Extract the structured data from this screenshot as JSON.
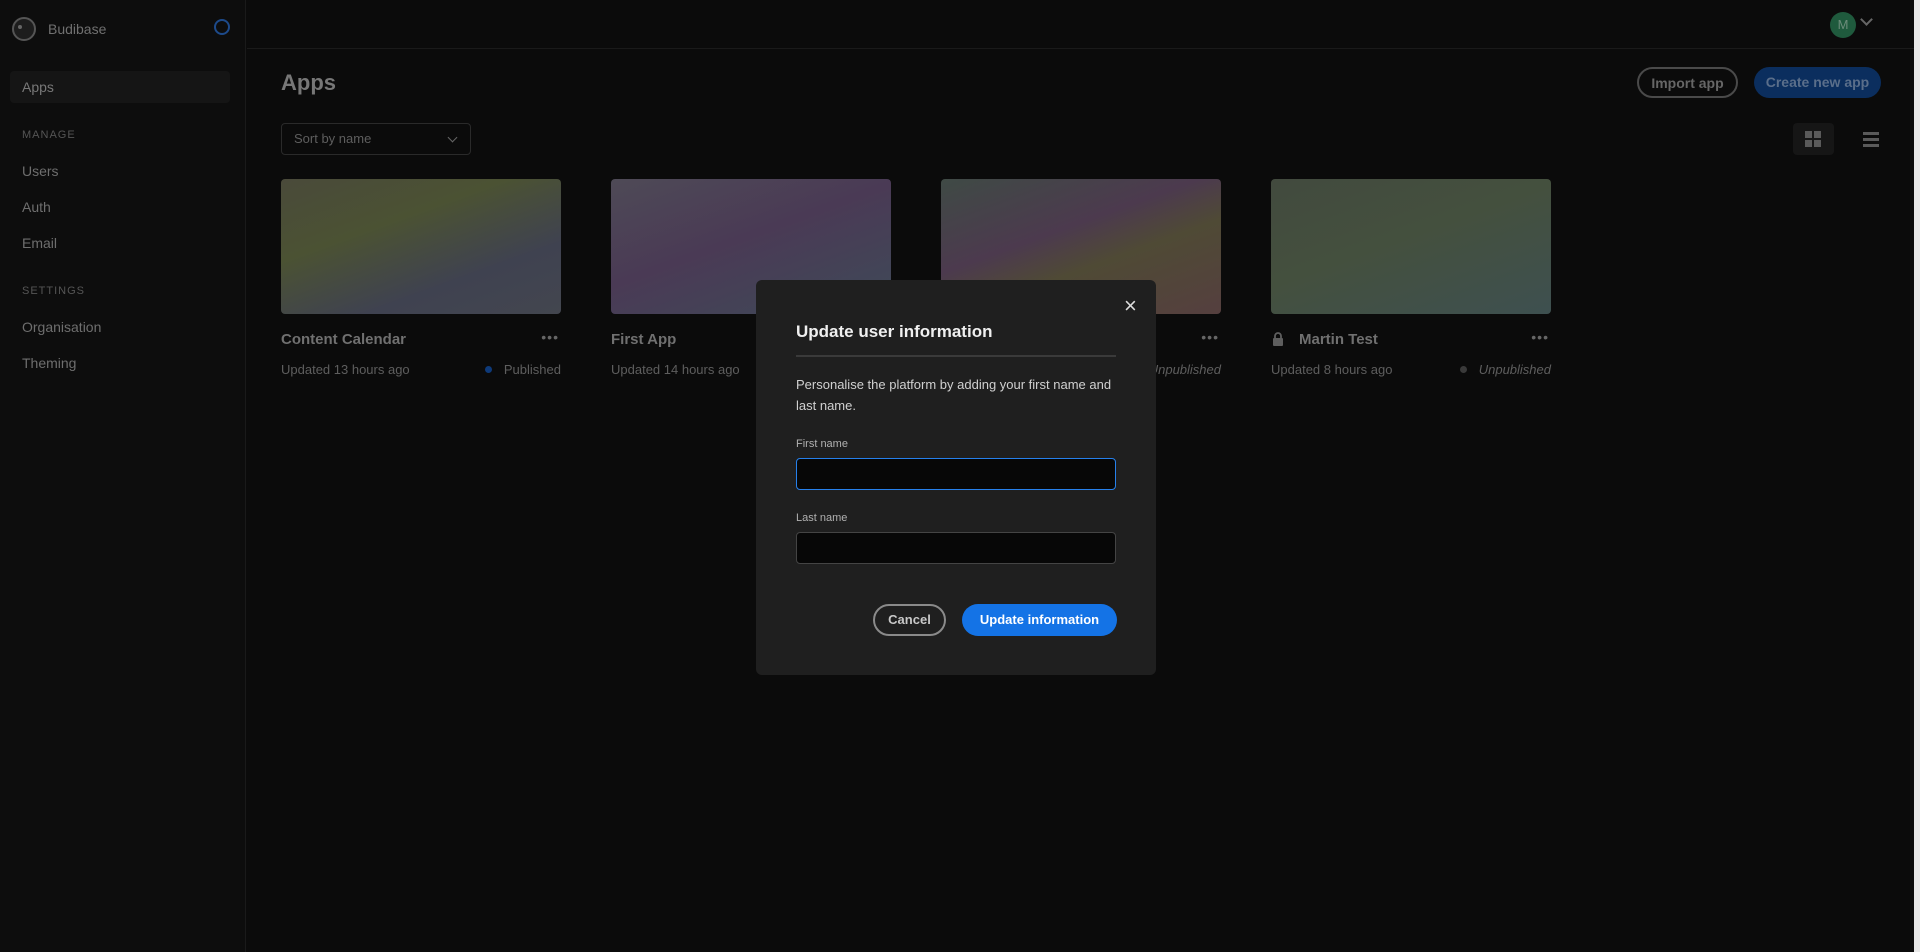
{
  "sidebar": {
    "brand": "Budibase",
    "items": [
      {
        "label": "Apps"
      }
    ],
    "manage_heading": "MANAGE",
    "manage": [
      {
        "label": "Users"
      },
      {
        "label": "Auth"
      },
      {
        "label": "Email"
      }
    ],
    "settings_heading": "SETTINGS",
    "settings": [
      {
        "label": "Organisation"
      },
      {
        "label": "Theming"
      }
    ]
  },
  "header": {
    "avatar_initial": "M"
  },
  "main": {
    "title": "Apps",
    "import_label": "Import app",
    "create_label": "Create new app",
    "sort_value": "Sort by name",
    "apps": [
      {
        "name": "Content Calendar",
        "updated": "Updated 13 hours ago",
        "status": "Published",
        "locked": false,
        "status_color": "#0e3a7a"
      },
      {
        "name": "First App",
        "updated": "Updated 14 hours ago",
        "status": "",
        "locked": false
      },
      {
        "name": "",
        "updated": "",
        "status": "Unpublished",
        "locked": false,
        "status_color": "#3a3a3a"
      },
      {
        "name": "Martin Test",
        "updated": "Updated 8 hours ago",
        "status": "Unpublished",
        "locked": true,
        "status_color": "#3a3a3a"
      }
    ]
  },
  "modal": {
    "title": "Update user information",
    "description": "Personalise the platform by adding your first name and last name.",
    "first_name_label": "First name",
    "first_name_value": "",
    "last_name_label": "Last name",
    "last_name_value": "",
    "cancel_label": "Cancel",
    "submit_label": "Update information",
    "close_icon": "×",
    "accent": "#1473e6"
  }
}
